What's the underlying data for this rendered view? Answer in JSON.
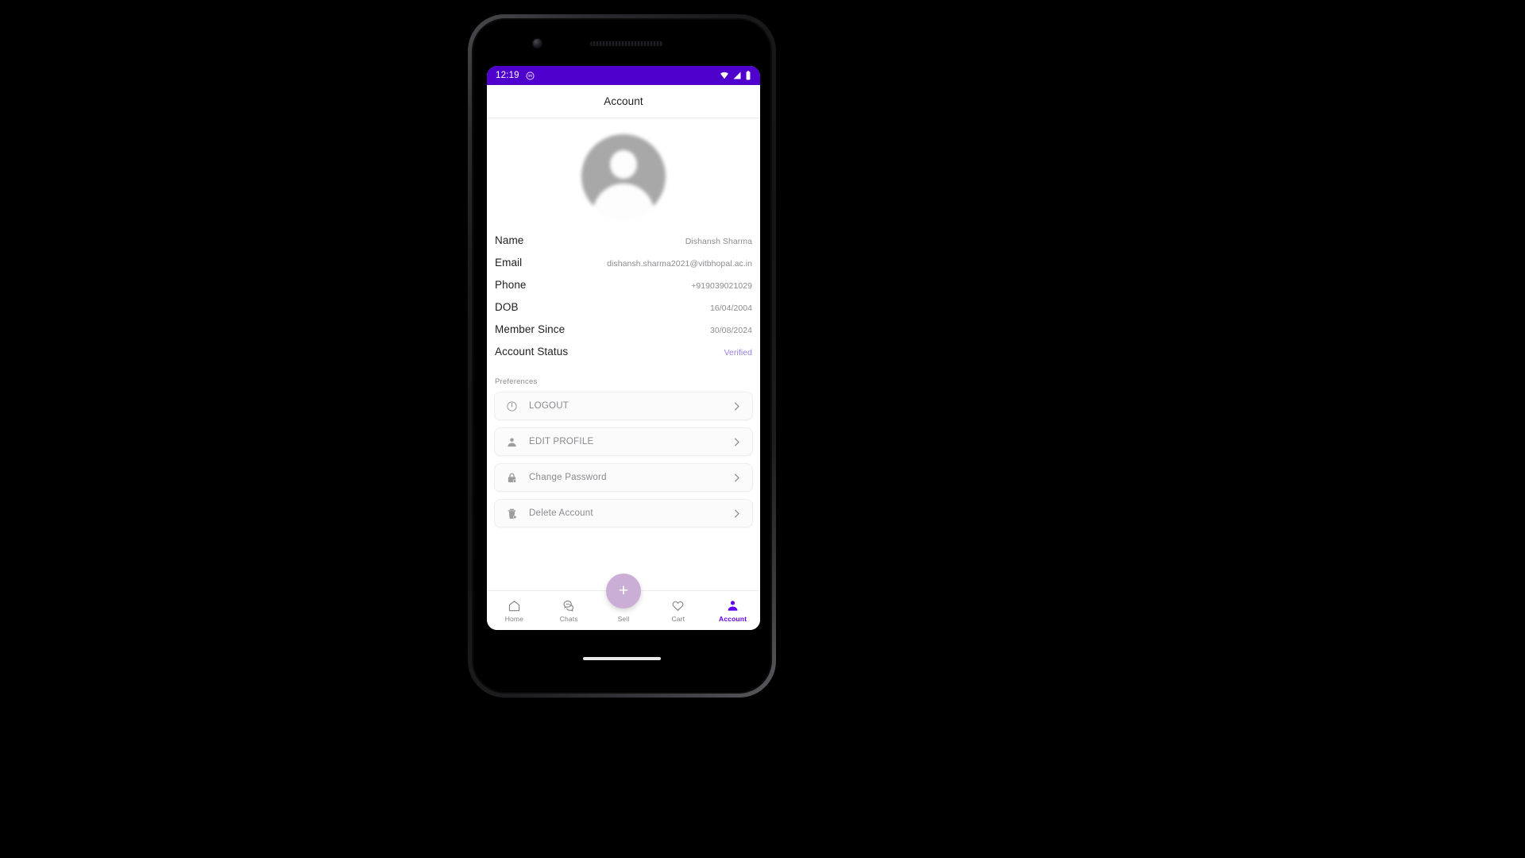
{
  "device": {
    "frame": "android-phone",
    "accent_color": "#6200ee",
    "status_bar_color": "#4f00cc"
  },
  "status_bar": {
    "time": "12:19",
    "notification_icon": "emoji-face-icon",
    "icons": [
      "wifi-icon",
      "cellular-signal-icon",
      "battery-icon"
    ]
  },
  "app_bar": {
    "title": "Account"
  },
  "profile": {
    "avatar_alt": "user-avatar",
    "details": [
      {
        "label": "Name",
        "value": "Dishansh Sharma"
      },
      {
        "label": "Email",
        "value": "dishansh.sharma2021@vitbhopal.ac.in"
      },
      {
        "label": "Phone",
        "value": "+919039021029"
      },
      {
        "label": "DOB",
        "value": "16/04/2004"
      },
      {
        "label": "Member Since",
        "value": "30/08/2024"
      },
      {
        "label": "Account Status",
        "value": "Verified",
        "status": true
      }
    ]
  },
  "preferences": {
    "heading": "Preferences",
    "items": [
      {
        "label": "LOGOUT",
        "icon": "power-icon"
      },
      {
        "label": "EDIT PROFILE",
        "icon": "person-icon"
      },
      {
        "label": "Change Password",
        "icon": "lock-icon"
      },
      {
        "label": "Delete Account",
        "icon": "trash-icon"
      }
    ]
  },
  "bottom_nav": {
    "fab": {
      "label": "+",
      "icon": "plus-icon",
      "color": "#cbaed6"
    },
    "items": [
      {
        "label": "Home",
        "icon": "home-icon",
        "active": false
      },
      {
        "label": "Chats",
        "icon": "chat-icon",
        "active": false
      },
      {
        "label": "Sell",
        "icon": "plus-icon",
        "active": false
      },
      {
        "label": "Cart",
        "icon": "heart-icon",
        "active": false
      },
      {
        "label": "Account",
        "icon": "account-icon",
        "active": true
      }
    ]
  },
  "colors": {
    "verified": "#9a7de0",
    "accent": "#6200ee",
    "status_bar": "#4f00cc",
    "fab": "#cbaed6"
  }
}
